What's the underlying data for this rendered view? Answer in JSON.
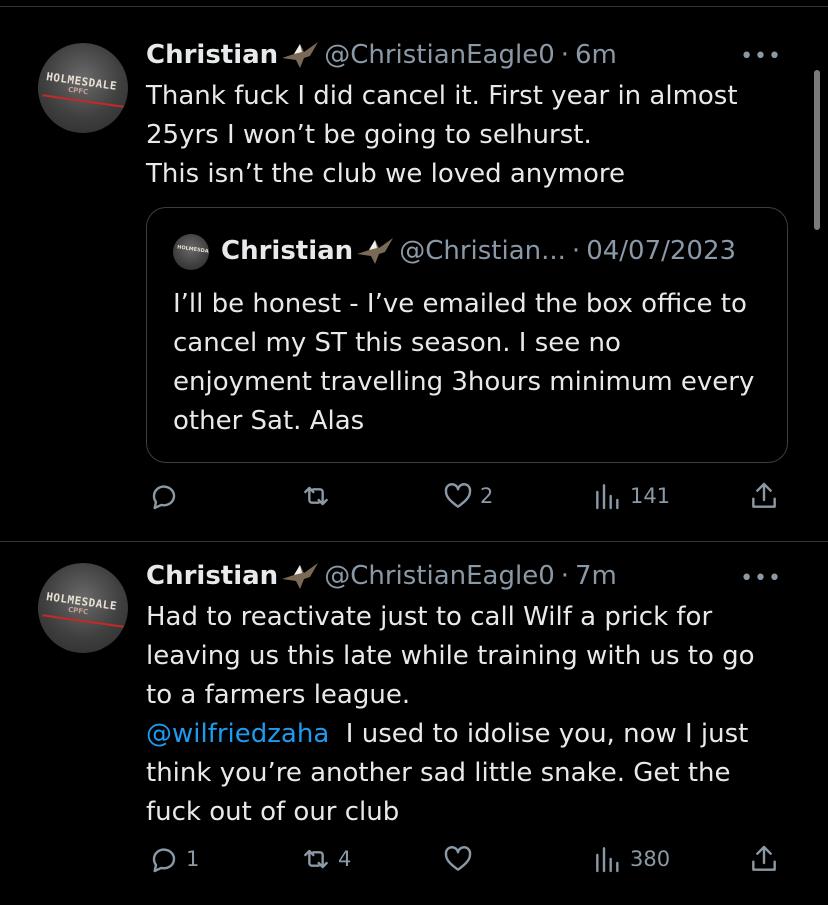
{
  "tweets": [
    {
      "name": "Christian",
      "handle": "@ChristianEagle0",
      "separator": "·",
      "time": "6m",
      "more": "•••",
      "avatar_text": "HOLMESDALE",
      "avatar_sub": "CPFC",
      "lines": [
        "Thank fuck I did cancel it. First year in almost",
        "25yrs I won’t be going to selhurst.",
        "This isn’t the club we loved anymore"
      ],
      "quote": {
        "name": "Christian",
        "handle": "@Christian...",
        "separator": "·",
        "date": "04/07/2023",
        "avatar_text": "HOLMESDALE",
        "lines": [
          "I’ll be honest - I’ve emailed the box office to",
          "cancel my ST this season. I see no",
          "enjoyment travelling 3hours minimum every",
          "other Sat. Alas"
        ]
      },
      "actions": {
        "reply": "",
        "retweet": "",
        "like": "2",
        "views": "141"
      }
    },
    {
      "name": "Christian",
      "handle": "@ChristianEagle0",
      "separator": "·",
      "time": "7m",
      "more": "•••",
      "avatar_text": "HOLMESDALE",
      "avatar_sub": "CPFC",
      "lines": [
        "Had to reactivate just to call Wilf a prick for",
        "leaving us this late while training with us to go",
        "to a farmers league."
      ],
      "mention": "@wilfriedzaha",
      "mention_rest": "  I used to idolise you, now I just",
      "more_lines": [
        "think you’re another sad little snake. Get the",
        "fuck out of our club"
      ],
      "actions": {
        "reply": "1",
        "retweet": "4",
        "like": "",
        "views": "380"
      }
    }
  ],
  "colors": {
    "background": "#000000",
    "text": "#e7e9ea",
    "secondary": "#8b98a5",
    "link": "#1d9bf0",
    "border": "#2f3336"
  }
}
